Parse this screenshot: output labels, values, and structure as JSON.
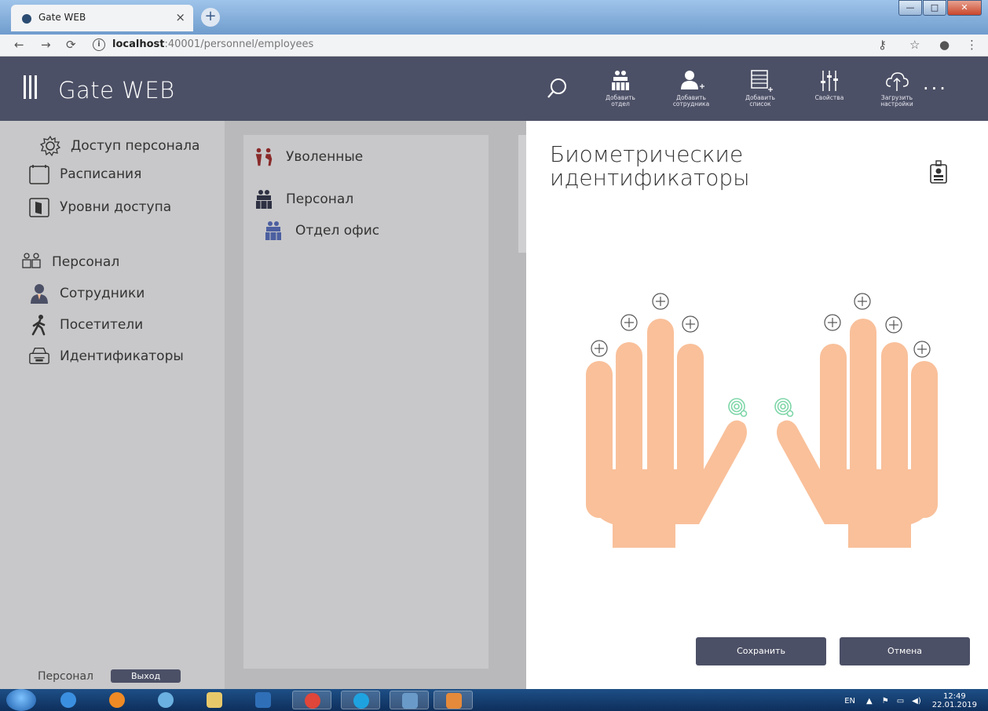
{
  "browser": {
    "tab_title": "Gate WEB",
    "tab_close": "×",
    "new_tab": "+",
    "url_host": "localhost",
    "url_rest": ":40001/personnel/employees"
  },
  "app": {
    "title": "Gate WEB",
    "toolbar": [
      {
        "icon": "add-department-icon",
        "label1": "Добавить",
        "label2": "отдел"
      },
      {
        "icon": "add-employee-icon",
        "label1": "Добавить",
        "label2": "сотрудника"
      },
      {
        "icon": "add-list-icon",
        "label1": "Добавить",
        "label2": "список"
      },
      {
        "icon": "properties-icon",
        "label1": "Свойства",
        "label2": ""
      },
      {
        "icon": "upload-settings-icon",
        "label1": "Загрузить",
        "label2": "настройки"
      }
    ],
    "more": "..."
  },
  "sidebar": {
    "access_group": "Доступ персонала",
    "schedules": "Расписания",
    "access_levels": "Уровни доступа",
    "personnel_group": "Персонал",
    "employees": "Сотрудники",
    "visitors": "Посетители",
    "identifiers": "Идентификаторы",
    "footer_label": "Персонал",
    "logout": "Выход"
  },
  "tree": {
    "fired": "Уволенные",
    "personnel": "Персонал",
    "office": "Отдел офис"
  },
  "panel": {
    "title_line1": "Биометрические",
    "title_line2": "идентификаторы",
    "add_symbol": "+",
    "save": "Сохранить",
    "cancel": "Отмена"
  },
  "taskbar": {
    "lang": "EN",
    "time": "12:49",
    "date": "22.01.2019"
  },
  "colors": {
    "header": "#4c5066",
    "sidebar": "#c8c8ca",
    "skin": "#f9c09a",
    "fingerprint": "#7ed6a8"
  }
}
